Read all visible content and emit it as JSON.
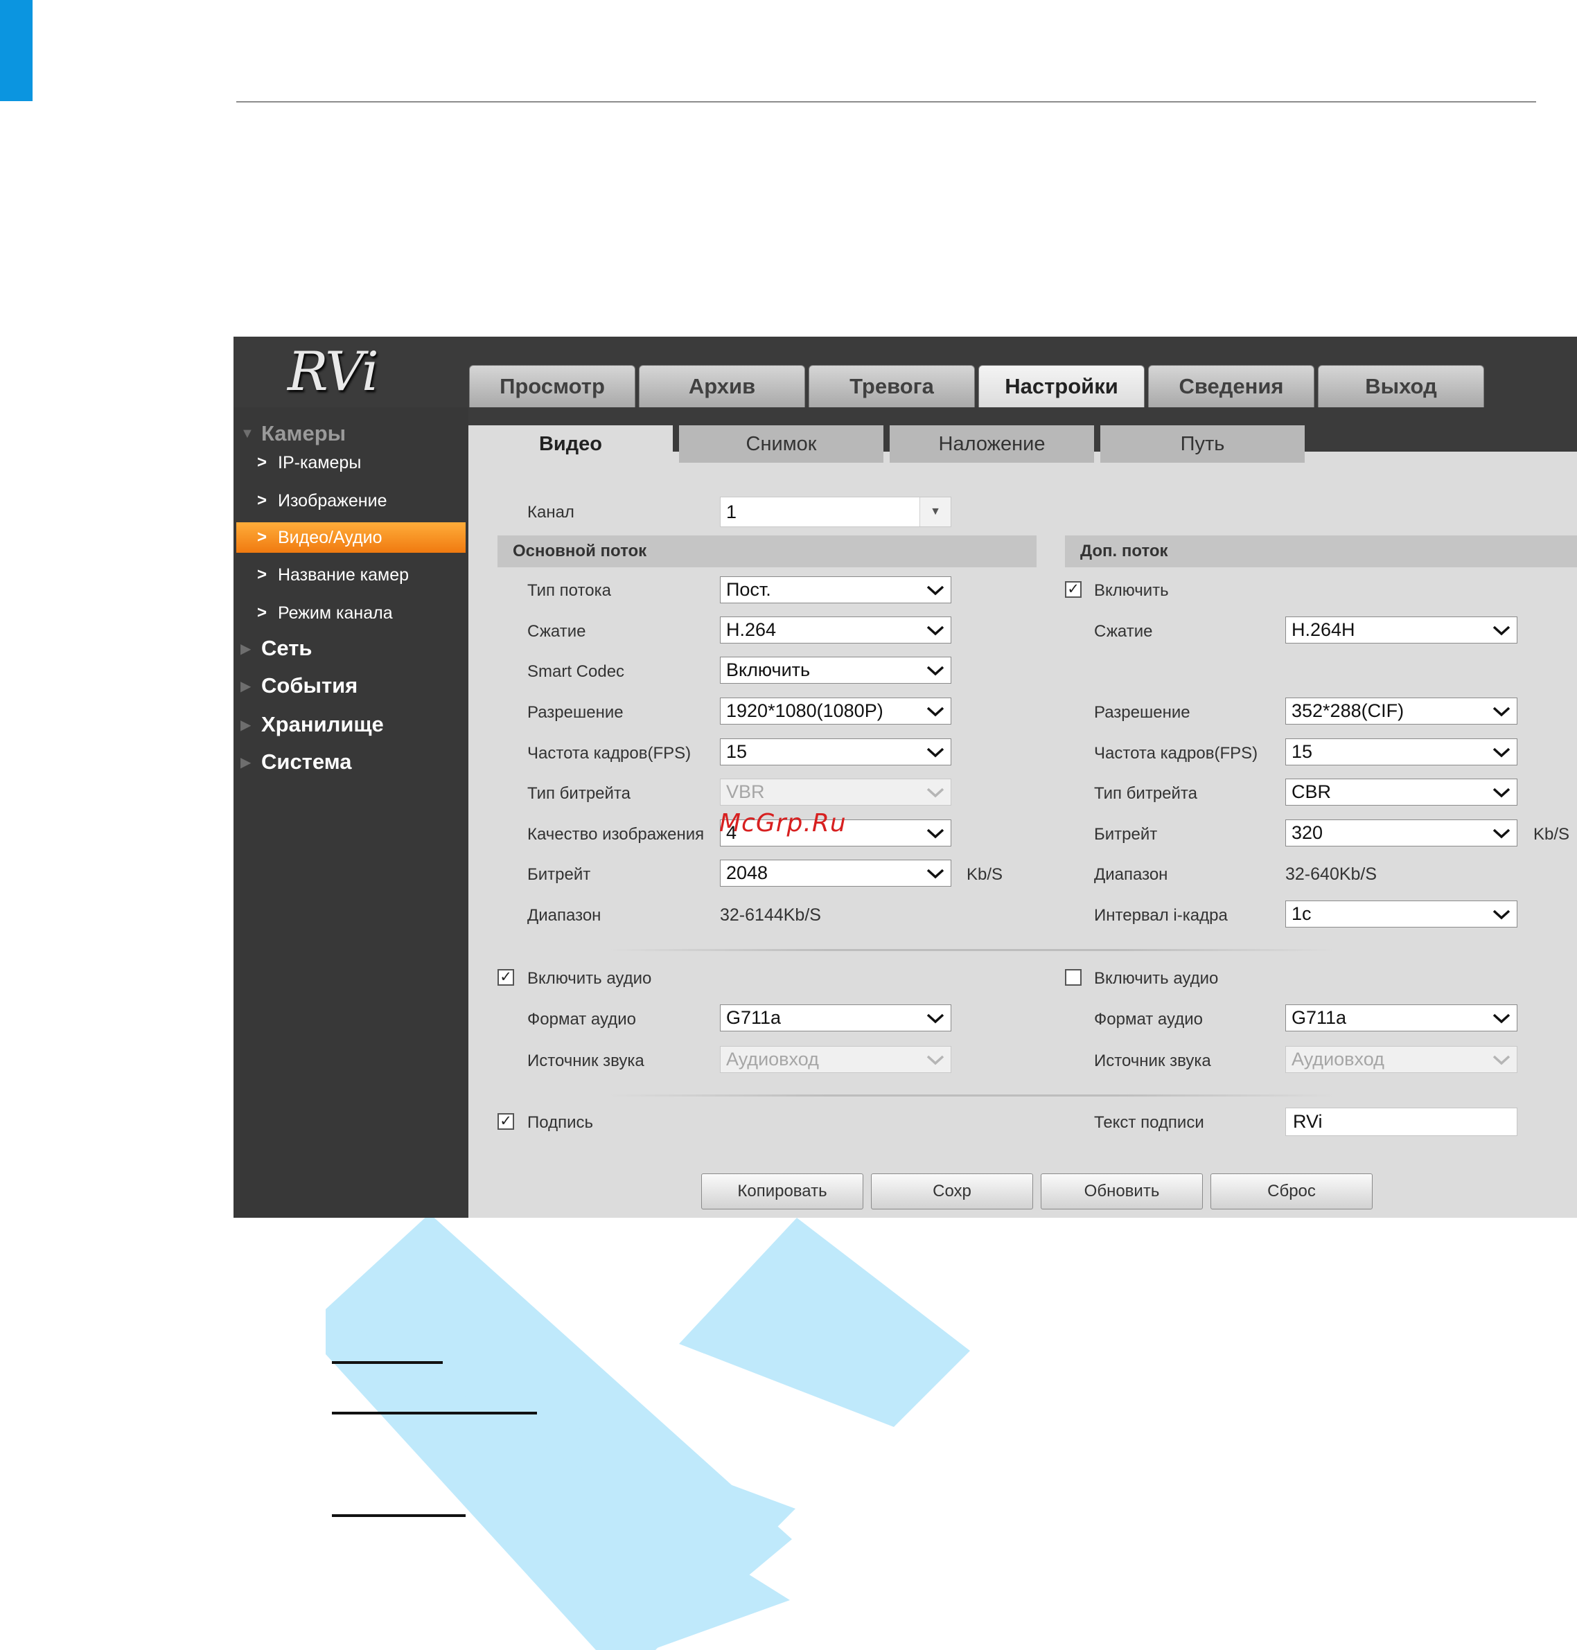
{
  "logo": "RVi",
  "main_tabs": [
    "Просмотр",
    "Архив",
    "Тревога",
    "Настройки",
    "Сведения",
    "Выход"
  ],
  "sidebar": {
    "cameras": "Камеры",
    "items": [
      "IP-камеры",
      "Изображение",
      "Видео/Аудио",
      "Название камер",
      "Режим канала"
    ],
    "network": "Сеть",
    "events": "События",
    "storage": "Хранилище",
    "system": "Система"
  },
  "sub_tabs": [
    "Видео",
    "Снимок",
    "Наложение",
    "Путь"
  ],
  "channel": {
    "label": "Канал",
    "value": "1"
  },
  "main_stream": {
    "title": "Основной поток",
    "stream_type": {
      "label": "Тип потока",
      "value": "Пост."
    },
    "compression": {
      "label": "Сжатие",
      "value": "H.264"
    },
    "smart_codec": {
      "label": "Smart Codec",
      "value": "Включить"
    },
    "resolution": {
      "label": "Разрешение",
      "value": "1920*1080(1080P)"
    },
    "fps": {
      "label": "Частота кадров(FPS)",
      "value": "15"
    },
    "bitrate_type": {
      "label": "Тип битрейта",
      "value": "VBR"
    },
    "quality": {
      "label": "Качество изображения",
      "value": "4"
    },
    "bitrate": {
      "label": "Битрейт",
      "value": "2048",
      "unit": "Kb/S"
    },
    "range": {
      "label": "Диапазон",
      "value": "32-6144Kb/S"
    },
    "audio_enable": "Включить аудио",
    "audio_format": {
      "label": "Формат аудио",
      "value": "G711a"
    },
    "audio_source": {
      "label": "Источник звука",
      "value": "Аудиовход"
    },
    "watermark": "Подпись"
  },
  "sub_stream": {
    "title": "Доп. поток",
    "enable": "Включить",
    "compression": {
      "label": "Сжатие",
      "value": "H.264H"
    },
    "resolution": {
      "label": "Разрешение",
      "value": "352*288(CIF)"
    },
    "fps": {
      "label": "Частота кадров(FPS)",
      "value": "15"
    },
    "bitrate_type": {
      "label": "Тип битрейта",
      "value": "CBR"
    },
    "bitrate": {
      "label": "Битрейт",
      "value": "320",
      "unit": "Kb/S"
    },
    "range": {
      "label": "Диапазон",
      "value": "32-640Kb/S"
    },
    "iframe": {
      "label": "Интервал i-кадра",
      "value": "1с"
    },
    "audio_enable": "Включить аудио",
    "audio_format": {
      "label": "Формат аудио",
      "value": "G711a"
    },
    "audio_source": {
      "label": "Источник звука",
      "value": "Аудиовход"
    },
    "watermark_text": {
      "label": "Текст подписи",
      "value": "RVi"
    }
  },
  "buttons": [
    "Копировать",
    "Сохр",
    "Обновить",
    "Сброс"
  ],
  "overlay_text": "McGrp.Ru",
  "colors": {
    "accent_blue": "#0b95e0",
    "active_orange": "#f7941d",
    "watermark_blue": "#bfe9fb"
  }
}
